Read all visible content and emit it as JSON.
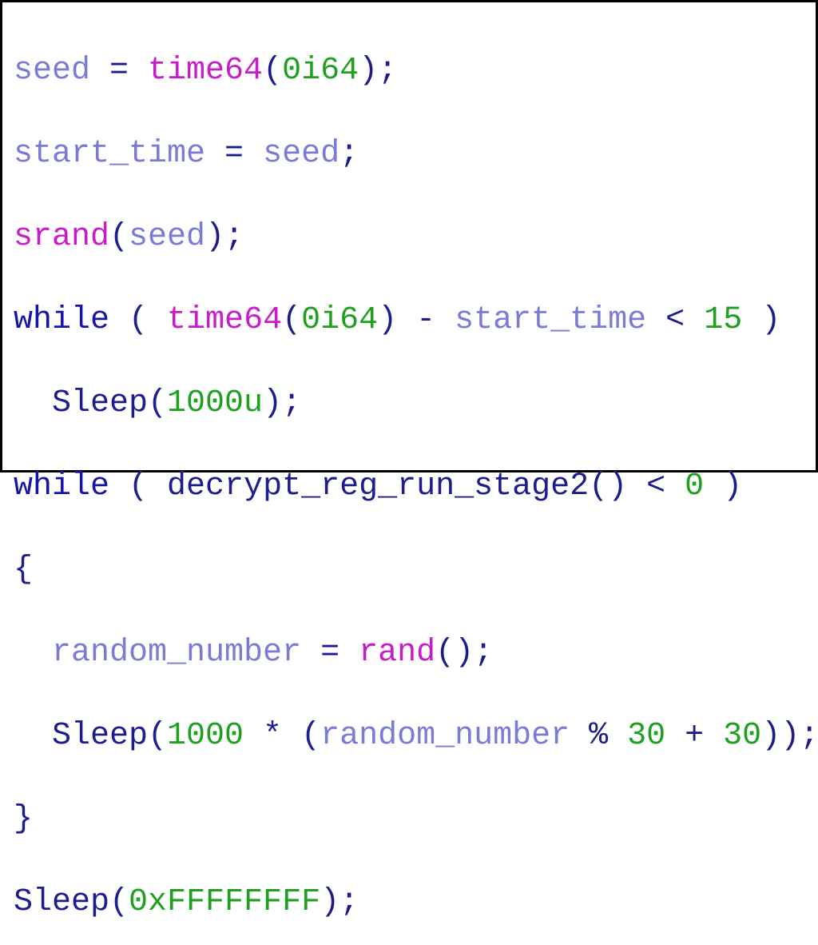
{
  "code": {
    "line1": {
      "t1": "seed",
      "t2": " = ",
      "t3": "time64",
      "t4": "(",
      "t5": "0i64",
      "t6": ");"
    },
    "line2": {
      "t1": "start_time",
      "t2": " = ",
      "t3": "seed",
      "t4": ";"
    },
    "line3": {
      "t1": "srand",
      "t2": "(",
      "t3": "seed",
      "t4": ");"
    },
    "line4": {
      "t1": "while",
      "t2": " ( ",
      "t3": "time64",
      "t4": "(",
      "t5": "0i64",
      "t6": ") - ",
      "t7": "start_time",
      "t8": " < ",
      "t9": "15",
      "t10": " )"
    },
    "line5": {
      "t1": "  Sleep(",
      "t2": "1000u",
      "t3": ");"
    },
    "line6": {
      "t1": "while",
      "t2": " ( decrypt_reg_run_stage2() < ",
      "t3": "0",
      "t4": " )"
    },
    "line7": {
      "t1": "{"
    },
    "line8": {
      "t1": "  ",
      "t2": "random_number",
      "t3": " = ",
      "t4": "rand",
      "t5": "();"
    },
    "line9": {
      "t1": "  Sleep(",
      "t2": "1000",
      "t3": " * (",
      "t4": "random_number",
      "t5": " % ",
      "t6": "30",
      "t7": " + ",
      "t8": "30",
      "t9": "));"
    },
    "line10": {
      "t1": "}"
    },
    "line11": {
      "t1": "Sleep(",
      "t2": "0xFFFFFFFF",
      "t3": ");"
    }
  }
}
